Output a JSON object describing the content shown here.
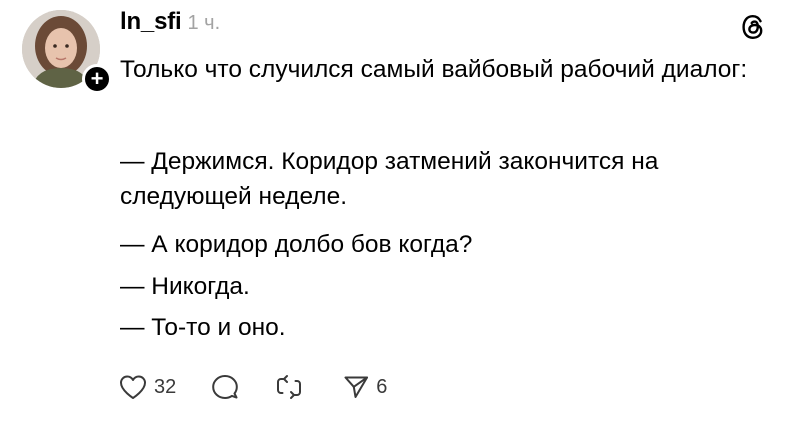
{
  "post": {
    "username": "ln_sfi",
    "timestamp": "1 ч.",
    "paragraphs": [
      "Только что случился самый вайбовый рабочий диалог:",
      "— Держимся. Коридор затмений закончится на следующей неделе.",
      "— А коридор долбо  бов когда?",
      "— Никогда.",
      "— То-то и оно."
    ],
    "actions": {
      "like_count": "32",
      "share_count": "6"
    },
    "icons": {
      "avatar": "avatar",
      "follow": "plus-icon",
      "brand": "threads-logo-icon",
      "like": "heart-icon",
      "reply": "comment-bubble-icon",
      "repost": "repost-arrows-icon",
      "share": "paper-plane-icon"
    },
    "colors": {
      "text": "#000000",
      "muted": "#a3a3a3",
      "icon": "#3a3a3a",
      "background": "#ffffff"
    }
  }
}
